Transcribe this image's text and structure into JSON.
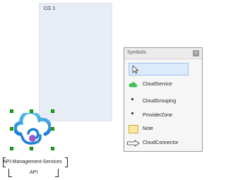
{
  "cloud_group": {
    "title": "CG 1"
  },
  "palette": {
    "title": "Symbols",
    "close_glyph": "×",
    "items": [
      {
        "label": "",
        "icon": "pointer-icon"
      },
      {
        "label": "CloudService",
        "icon": "cloud-icon"
      },
      {
        "label": "CloudGrouping",
        "icon": "dot-icon"
      },
      {
        "label": "ProviderZone",
        "icon": "dot-icon"
      },
      {
        "label": "Note",
        "icon": "note-icon"
      },
      {
        "label": "CloudConnector",
        "icon": "connector-arrow-icon"
      }
    ]
  },
  "api_shape": {
    "name": "API-Management-Services",
    "sublabel": "API",
    "icon": "api-management-cloud-icon"
  },
  "colors": {
    "group_fill": "#e8edf5",
    "selection_handle": "#18b418",
    "cloud_icon": "#2b9fe0",
    "palette_selected": "#dbeafc",
    "cloud_service_icon": "#3dbf53",
    "note_fill": "#fbe89a"
  }
}
